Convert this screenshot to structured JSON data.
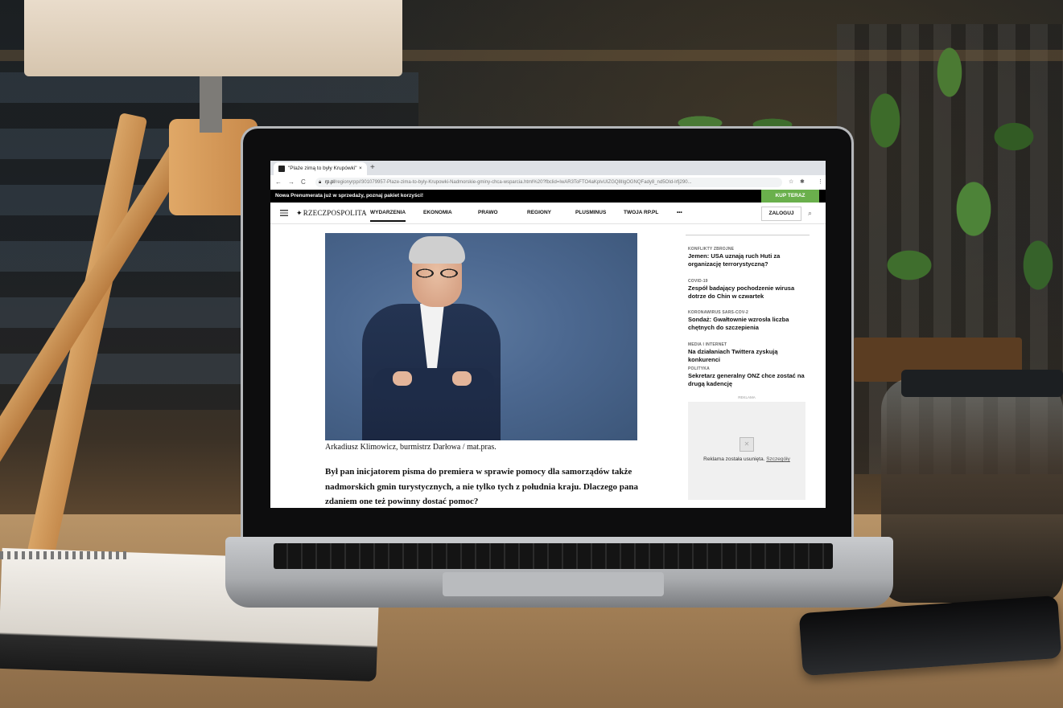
{
  "browser": {
    "tab_title": "\"Plaże zimą to były Krupówki\"",
    "tab_close": "×",
    "new_tab": "+",
    "back": "←",
    "forward": "→",
    "reload": "C",
    "url_host": "rp.pl",
    "url_path": "/regionyrpp//301079957-Plaze-zima-to-byly-Krupowki-Nadmorskie-gminy-chca-wsparcia.html%20?fbclid=IwAR3ToFTO4aKplvUIZGQ8IlgOGNQFady8_nd5OId-lrfj290...",
    "star": "☆",
    "extensions": "✱",
    "menu": "⋮"
  },
  "promo": {
    "text": "Nowa Prenumerata już w sprzedaży, poznaj pakiet korzyści!",
    "button": "KUP TERAZ",
    "button_color": "#6ab04c"
  },
  "site": {
    "logo": "RZECZPOSPOLITA",
    "nav": [
      "WYDARZENIA",
      "EKONOMIA",
      "PRAWO",
      "REGIONY",
      "PLUSMINUS",
      "TWOJA RP.PL",
      "•••"
    ],
    "login": "ZALOGUJ",
    "search_icon": "⌕"
  },
  "article": {
    "caption": "Arkadiusz Klimowicz, burmistrz Darłowa / mat.pras.",
    "lead": "Był pan inicjatorem pisma do premiera w sprawie pomocy dla samorządów także nadmorskich gmin turystycznych, a nie tylko tych z południa kraju. Dlaczego pana zdaniem one też powinny dostać pomoc?"
  },
  "sidebar": {
    "items": [
      {
        "category": "KONFLIKTY ZBROJNE",
        "title": "Jemen: USA uznają ruch Huti za organizację terrorystyczną?"
      },
      {
        "category": "COVID-19",
        "title": "Zespół badający pochodzenie wirusa dotrze do Chin w czwartek"
      },
      {
        "category": "KORONAWIRUS SARS-COV-2",
        "title": "Sondaż: Gwałtownie wzrosła liczba chętnych do szczepienia"
      },
      {
        "category": "MEDIA I INTERNET",
        "title": "Na działaniach Twittera zyskują konkurenci"
      },
      {
        "category": "POLITYKA",
        "title": "Sekretarz generalny ONZ chce zostać na drugą kadencję"
      }
    ],
    "ad_label": "REKLAMA",
    "ad_text": "Reklama została usunięta.",
    "ad_link": "Szczegóły"
  }
}
